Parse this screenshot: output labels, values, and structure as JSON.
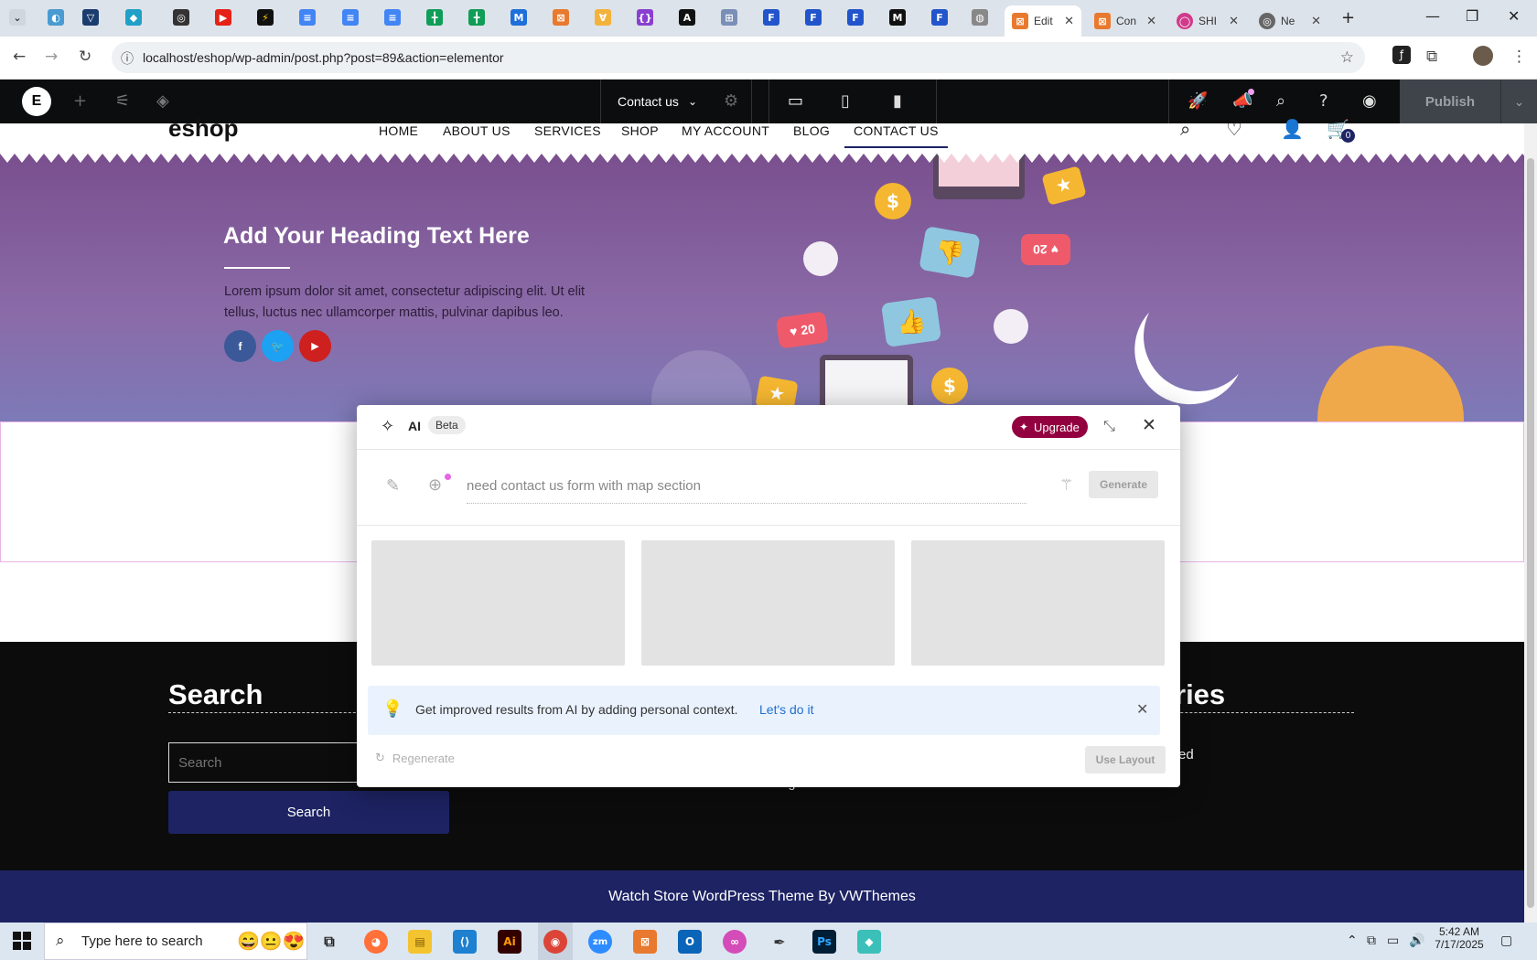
{
  "browser": {
    "tabs": [
      {
        "label": "Edit",
        "active": true
      },
      {
        "label": "Con",
        "active": false
      },
      {
        "label": "SHI",
        "active": false
      },
      {
        "label": "Ne",
        "active": false
      }
    ],
    "new_tab": "+",
    "url": "localhost/eshop/wp-admin/post.php?post=89&action=elementor"
  },
  "elementor_bar": {
    "page_label": "Contact us",
    "publish_label": "Publish"
  },
  "site": {
    "logo": "eshop",
    "menu": [
      "HOME",
      "ABOUT US",
      "SERVICES",
      "SHOP",
      "MY ACCOUNT",
      "BLOG",
      "CONTACT US"
    ],
    "active_menu": "CONTACT US",
    "cart_count": "0"
  },
  "hero": {
    "heading": "Add Your Heading Text Here",
    "text": "Lorem ipsum dolor sit amet, consectetur adipiscing elit. Ut elit tellus, luctus nec ullamcorper mattis, pulvinar dapibus leo.",
    "social_icons": [
      "facebook-icon",
      "twitter-icon",
      "youtube-icon"
    ],
    "like_count_1": "20",
    "like_count_2": "20",
    "coin_symbol": "$"
  },
  "footer": {
    "search_heading": "Search",
    "search_placeholder": "Search",
    "search_button": "Search",
    "right_heading_fragment": "ries",
    "right_text_fragment": "ed",
    "center_text_fragment": "Log out",
    "copyright": "Watch Store WordPress Theme By VWThemes"
  },
  "ai_modal": {
    "title": "AI",
    "badge": "Beta",
    "upgrade_label": "Upgrade",
    "prompt_value": "need contact us form with map section",
    "generate_label": "Generate",
    "tip_text": "Get improved results from AI by adding personal context.",
    "tip_link": "Let's do it",
    "regenerate_label": "Regenerate",
    "use_layout_label": "Use Layout",
    "colors": {
      "upgrade_bg": "#93003f",
      "tip_bg": "#eaf2fd",
      "link": "#1f6fd1"
    }
  },
  "taskbar": {
    "search_placeholder": "Type here to search",
    "time": "5:42 AM",
    "date": "7/17/2025"
  }
}
